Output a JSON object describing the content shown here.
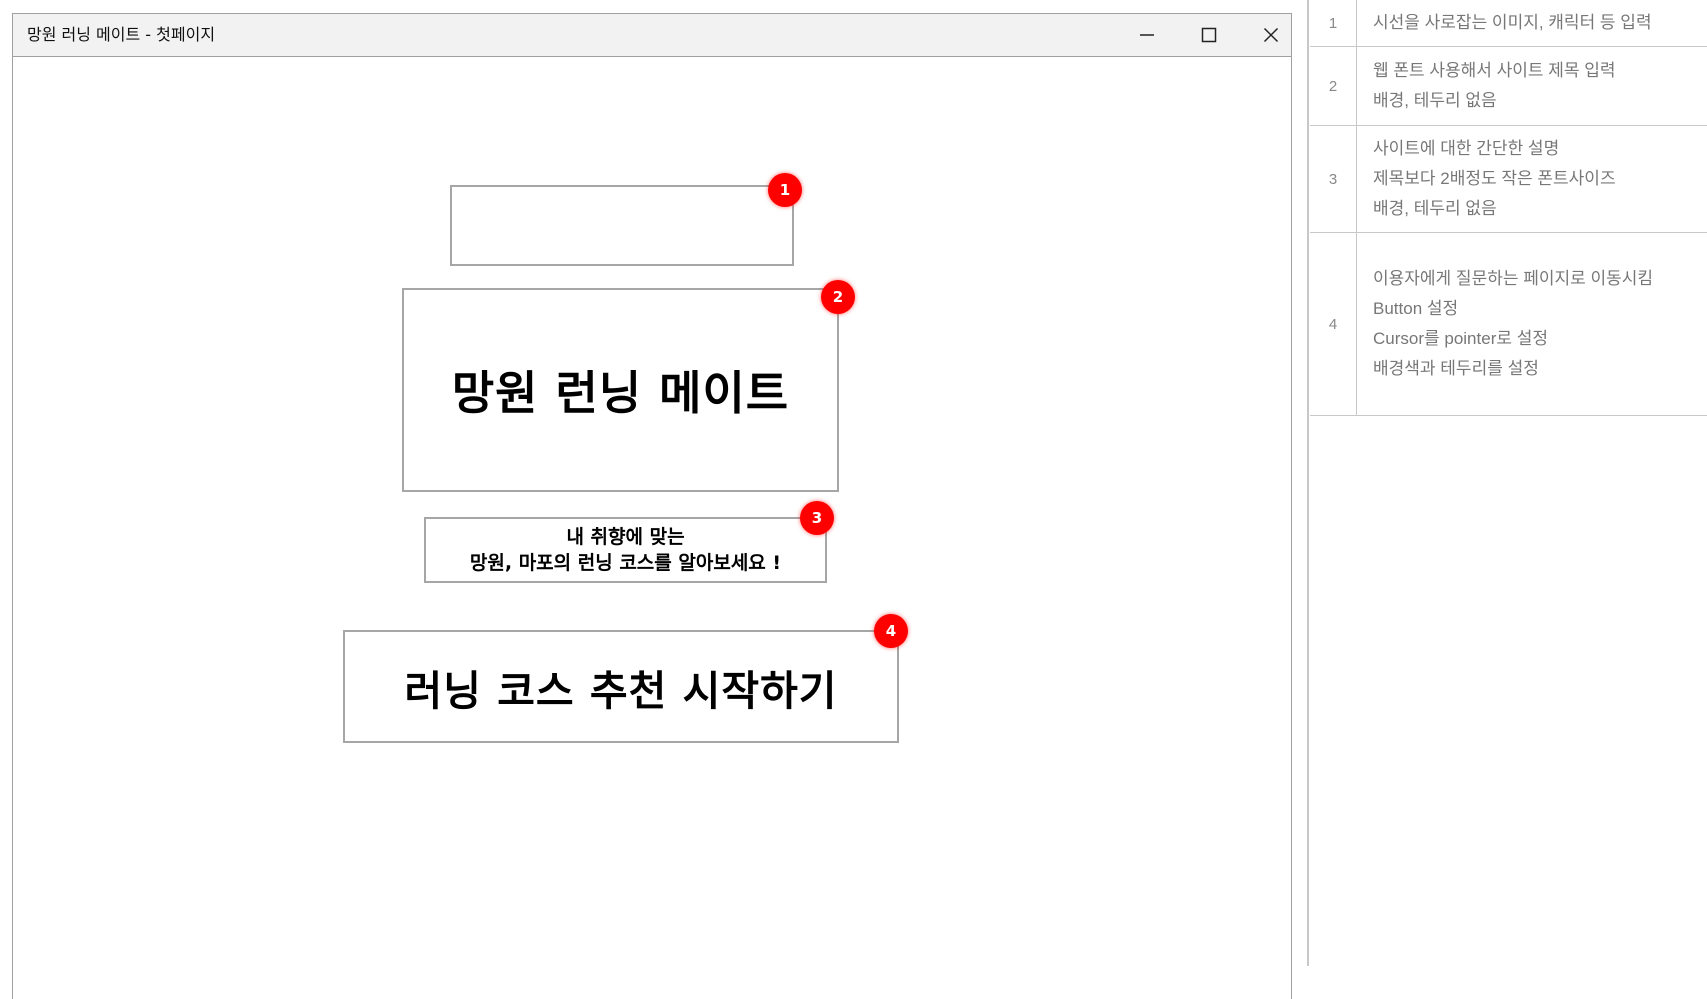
{
  "window": {
    "title": "망원 러닝 메이트 - 첫페이지",
    "controls": {
      "minimize": "minimize-icon",
      "maximize": "maximize-icon",
      "close": "close-icon"
    }
  },
  "wireframe": {
    "image_box": {
      "badge": "1"
    },
    "title_box": {
      "badge": "2",
      "text": "망원 런닝 메이트"
    },
    "desc_box": {
      "badge": "3",
      "line1": "내 취향에 맞는",
      "line2": "망원, 마포의 런닝 코스를 알아보세요 !"
    },
    "start_button": {
      "badge": "4",
      "label": "러닝 코스 추천 시작하기"
    }
  },
  "notes": [
    {
      "num": "1",
      "lines": [
        "시선을 사로잡는 이미지, 캐릭터 등 입력"
      ]
    },
    {
      "num": "2",
      "lines": [
        "웹 폰트 사용해서 사이트 제목 입력",
        "배경, 테두리 없음"
      ]
    },
    {
      "num": "3",
      "lines": [
        "사이트에 대한 간단한 설명",
        "제목보다 2배정도 작은 폰트사이즈",
        "배경, 테두리 없음"
      ]
    },
    {
      "num": "4",
      "lines": [
        "이용자에게 질문하는 페이지로 이동시킴",
        "Button 설정",
        "Cursor를 pointer로 설정",
        "배경색과 테두리를 설정"
      ]
    }
  ],
  "colors": {
    "badge": "#ff0000",
    "box_border": "#a6a6a6",
    "note_text": "#777777"
  }
}
